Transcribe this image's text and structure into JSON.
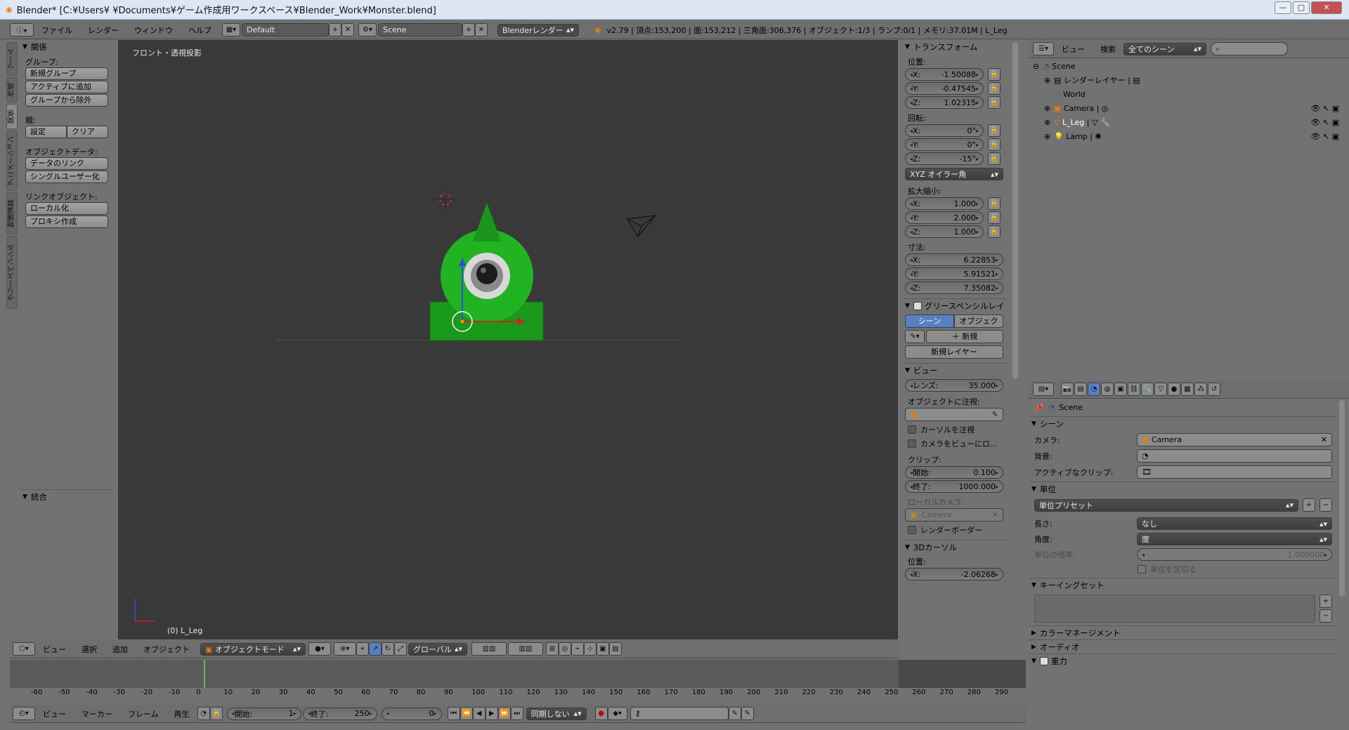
{
  "window": {
    "title": "Blender* [C:¥Users¥      ¥Documents¥ゲーム作成用ワークスペース¥Blender_Work¥Monster.blend]"
  },
  "info_header": {
    "menus": [
      "ファイル",
      "レンダー",
      "ウィンドウ",
      "ヘルプ"
    ],
    "layout": "Default",
    "scene": "Scene",
    "engine": "Blenderレンダー",
    "stats": "v2.79 | 頂点:153,200 | 面:153,212 | 三角面:306,376 | オブジェクト:1/3 | ランプ:0/1 | メモリ:37.01M | L_Leg"
  },
  "tool_tabs": [
    "ツール",
    "作成",
    "関係",
    "アニメーション",
    "物理演算",
    "グリースペンシル"
  ],
  "tool_shelf": {
    "relations_title": "関係",
    "groups_label": "グループ:",
    "group_buttons": [
      "新規グループ",
      "アクティブに追加",
      "グループから除外"
    ],
    "parent_label": "親:",
    "parent_buttons": [
      "設定",
      "クリア"
    ],
    "objdata_label": "オブジェクトデータ:",
    "objdata_buttons": [
      "データのリンク",
      "シングルユーザー化"
    ],
    "linked_label": "リンクオブジェクト:",
    "linked_buttons": [
      "ローカル化",
      "プロキシ作成"
    ],
    "history_title": "統合"
  },
  "viewport": {
    "view_name": "フロント・透視投影",
    "object_label": "(0) L_Leg"
  },
  "properties_n": {
    "transform_title": "トランスフォーム",
    "location_label": "位置:",
    "location": [
      {
        "axis": "X:",
        "value": "-1.50088"
      },
      {
        "axis": "Y:",
        "value": "-0.47545"
      },
      {
        "axis": "Z:",
        "value": "1.02315"
      }
    ],
    "rotation_label": "回転:",
    "rotation": [
      {
        "axis": "X:",
        "value": "0°"
      },
      {
        "axis": "Y:",
        "value": "0°"
      },
      {
        "axis": "Z:",
        "value": "-15°"
      }
    ],
    "rotation_mode": "XYZ オイラー角",
    "scale_label": "拡大縮小:",
    "scale": [
      {
        "axis": "X:",
        "value": "1.000"
      },
      {
        "axis": "Y:",
        "value": "2.000"
      },
      {
        "axis": "Z:",
        "value": "1.000"
      }
    ],
    "dims_label": "寸法:",
    "dims": [
      {
        "axis": "X:",
        "value": "6.22853"
      },
      {
        "axis": "Y:",
        "value": "5.91521"
      },
      {
        "axis": "Z:",
        "value": "7.35082"
      }
    ],
    "gp_title": "グリースペンシルレイ",
    "gp_scene": "シーン",
    "gp_object": "オブジェクト",
    "gp_new": "新規",
    "gp_new_layer": "新規レイヤー",
    "view_title": "ビュー",
    "lens_label": "レンズ:",
    "lens_value": "35.000",
    "lock_label": "オブジェクトに注視:",
    "lock_cursor": "カーソルを注視",
    "lock_camera": "カメラをビューにロ...",
    "clip_label": "クリップ:",
    "clip_start_label": "開始:",
    "clip_start": "0.100",
    "clip_end_label": "終了:",
    "clip_end": "1000.000",
    "local_cam_label": "ローカルカメラ:",
    "local_cam": "Camera",
    "render_border": "レンダーボーダー",
    "cursor_title": "3Dカーソル",
    "cursor_loc_label": "位置:",
    "cursor_x_label": "X:",
    "cursor_x": "-2.06268"
  },
  "viewport_header": {
    "menus": [
      "ビュー",
      "選択",
      "追加",
      "オブジェクト"
    ],
    "mode": "オブジェクトモード",
    "orientation": "グローバル"
  },
  "timeline": {
    "ticks": [
      "-60",
      "-50",
      "-40",
      "-30",
      "-20",
      "-10",
      "0",
      "10",
      "20",
      "30",
      "40",
      "50",
      "60",
      "70",
      "80",
      "90",
      "100",
      "110",
      "120",
      "130",
      "140",
      "150",
      "160",
      "170",
      "180",
      "190",
      "200",
      "210",
      "220",
      "230",
      "240",
      "250",
      "260",
      "270",
      "280",
      "290"
    ]
  },
  "timeline_header": {
    "menus": [
      "ビュー",
      "マーカー",
      "フレーム",
      "再生"
    ],
    "start_label": "開始:",
    "start": "1",
    "end_label": "終了:",
    "end": "250",
    "current": "0",
    "sync": "同期しない"
  },
  "outliner": {
    "menus": [
      "ビュー",
      "検索"
    ],
    "filter": "全てのシーン",
    "items": [
      "Scene",
      "レンダーレイヤー",
      "World",
      "Camera",
      "L_Leg",
      "Lamp"
    ]
  },
  "props": {
    "context": "Scene",
    "scene_title": "シーン",
    "camera_label": "カメラ:",
    "camera": "Camera",
    "background_label": "背景:",
    "clip_label": "アクティブなクリップ:",
    "units_title": "単位",
    "unit_preset": "単位プリセット",
    "length_label": "長さ:",
    "length": "なし",
    "angle_label": "角度:",
    "angle": "度",
    "scale_label": "単位の倍率:",
    "scale": "1.000000",
    "separate": "単位を区切る",
    "keying_title": "キーイングセット",
    "color_mgmt": "カラーマネージメント",
    "audio": "オーディオ",
    "gravity": "重力"
  },
  "colors": {
    "viewport_bg": "#393939",
    "monster_green": "#18b418",
    "accent_blue": "#5680c2"
  }
}
